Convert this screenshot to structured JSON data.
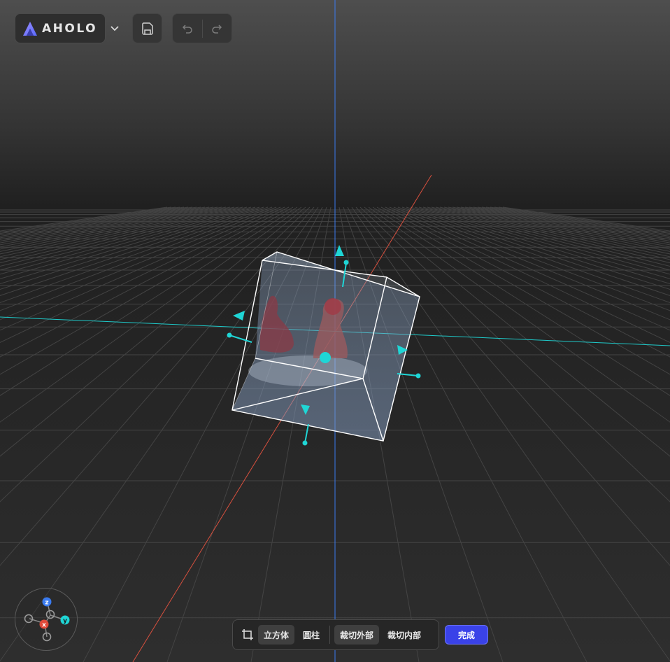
{
  "app": {
    "logo_text": "AHOLO"
  },
  "toolbar": {
    "dropdown_icon": "chevron-down-icon",
    "save_icon": "save-icon",
    "undo_icon": "undo-icon",
    "redo_icon": "redo-icon"
  },
  "axis_gizmo": {
    "z_label": "z",
    "x_label": "x",
    "y_label": "y"
  },
  "crop_tools": {
    "icon": "crop-icon",
    "shape_cube": "立方体",
    "shape_cylinder": "圆柱",
    "crop_outside": "裁切外部",
    "crop_inside": "裁切内部",
    "done": "完成"
  },
  "colors": {
    "accent": "#3a42e8",
    "handle": "#1fd6d6",
    "axis_x": "#e04a3a",
    "axis_y": "#1fd6d6",
    "axis_z": "#3a7bf0",
    "background": "#2b2b2b"
  }
}
